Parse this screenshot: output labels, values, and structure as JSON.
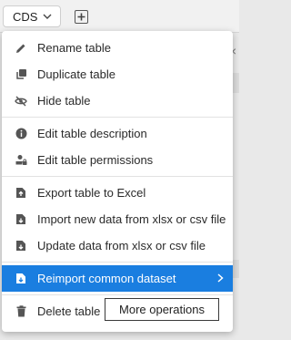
{
  "tab": {
    "label": "CDS"
  },
  "menu": {
    "items": [
      {
        "label": "Rename table",
        "icon": "pencil-icon"
      },
      {
        "label": "Duplicate table",
        "icon": "duplicate-icon"
      },
      {
        "label": "Hide table",
        "icon": "eye-off-icon"
      },
      {
        "label": "Edit table description",
        "icon": "info-icon"
      },
      {
        "label": "Edit table permissions",
        "icon": "lock-person-icon"
      },
      {
        "label": "Export table to Excel",
        "icon": "export-icon"
      },
      {
        "label": "Import new data from xlsx or csv file",
        "icon": "import-icon"
      },
      {
        "label": "Update data from xlsx or csv file",
        "icon": "import-icon"
      },
      {
        "label": "Reimport common dataset",
        "icon": "reimport-icon"
      },
      {
        "label": "Delete table",
        "icon": "trash-icon"
      }
    ]
  },
  "tooltip": {
    "text": "More operations"
  },
  "colors": {
    "accent": "#1a7ee0"
  }
}
